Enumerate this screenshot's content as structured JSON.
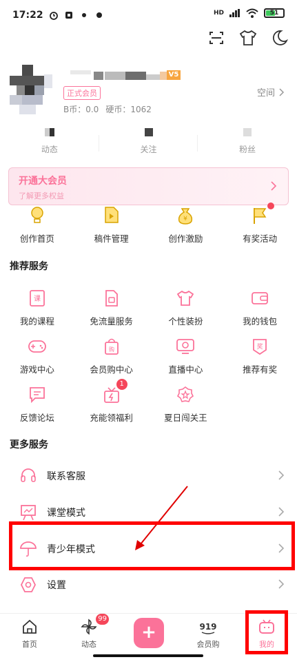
{
  "status_bar": {
    "time": "17:22",
    "network": "HD",
    "battery": "51"
  },
  "top_icons": [
    "scan-icon",
    "tshirt-icon",
    "night-mode-icon"
  ],
  "profile": {
    "vip_label": "正式会员",
    "level_badge": "V5",
    "b_coin": "B币：0.0",
    "coin": "硬币：1062",
    "space_label": "空间"
  },
  "stats": [
    {
      "label": "动态"
    },
    {
      "label": "关注"
    },
    {
      "label": "粉丝"
    }
  ],
  "member_banner": {
    "title": "开通大会员",
    "subtitle": "了解更多权益"
  },
  "creator": [
    {
      "label": "创作首页",
      "icon": "lightbulb-icon"
    },
    {
      "label": "稿件管理",
      "icon": "manuscript-icon"
    },
    {
      "label": "创作激励",
      "icon": "money-bag-icon"
    },
    {
      "label": "有奖活动",
      "icon": "flag-icon"
    }
  ],
  "recommended": {
    "title": "推荐服务",
    "items": [
      {
        "label": "我的课程",
        "icon": "course-icon"
      },
      {
        "label": "免流量服务",
        "icon": "sim-card-icon"
      },
      {
        "label": "个性装扮",
        "icon": "tshirt-icon"
      },
      {
        "label": "我的钱包",
        "icon": "wallet-icon"
      },
      {
        "label": "游戏中心",
        "icon": "gamepad-icon"
      },
      {
        "label": "会员购中心",
        "icon": "shopping-bag-icon"
      },
      {
        "label": "直播中心",
        "icon": "live-tv-icon"
      },
      {
        "label": "推荐有奖",
        "icon": "reward-icon"
      },
      {
        "label": "反馈论坛",
        "icon": "feedback-icon"
      },
      {
        "label": "充能领福利",
        "icon": "gift-icon",
        "badge": "1"
      },
      {
        "label": "夏日闯关王",
        "icon": "medal-icon"
      }
    ]
  },
  "more": {
    "title": "更多服务",
    "items": [
      {
        "label": "联系客服",
        "icon": "headset-icon"
      },
      {
        "label": "课堂模式",
        "icon": "classroom-icon"
      },
      {
        "label": "青少年模式",
        "icon": "umbrella-icon"
      },
      {
        "label": "设置",
        "icon": "settings-icon"
      }
    ]
  },
  "bottom_nav": [
    {
      "label": "首页",
      "icon": "home-icon"
    },
    {
      "label": "动态",
      "icon": "pinwheel-icon",
      "badge": "99"
    },
    {
      "label": "会员购",
      "icon": "mall-icon"
    },
    {
      "label": "我的",
      "icon": "tv-mine-icon"
    }
  ],
  "colors": {
    "accent": "#fb7299",
    "highlight": "#ff0000"
  }
}
